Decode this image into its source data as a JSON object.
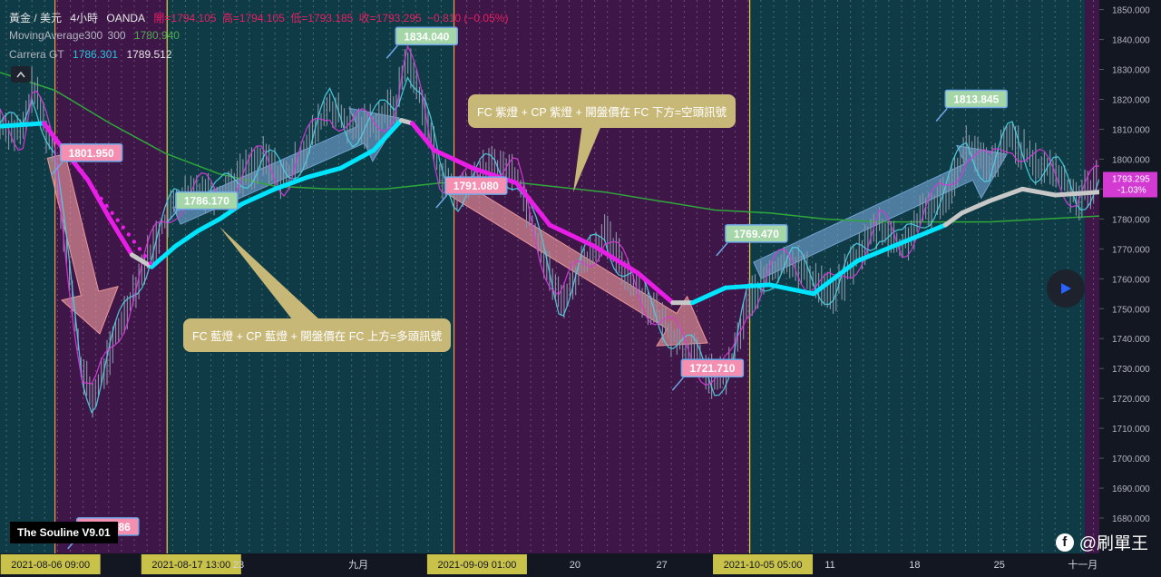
{
  "header": {
    "symbol": "黃金 / 美元",
    "interval": "4小時",
    "exchange": "OANDA",
    "open": "開=1794.105",
    "high": "高=1794.105",
    "low": "低=1793.185",
    "close": "收=1793.295",
    "change": "−0.810 (−0.05%)",
    "ma_name": "MovingAverage300",
    "ma_period": "300",
    "ma_value": "1780.940",
    "carrera_name": "Carrera GT",
    "carrera_v1": "1786.301",
    "carrera_v2": "1789.512"
  },
  "watermark": "The Souline V9.01",
  "brand": "@刷單王",
  "annotations": {
    "short_signal": "FC 紫燈 + CP 紫燈 + 開盤價在 FC 下方=空頭訊號",
    "long_signal": "FC 藍燈 + CP 藍燈 + 開盤價在 FC 上方=多頭訊號"
  },
  "colors": {
    "background": "#131722",
    "teal_zone": "#0f3b46",
    "purple_zone": "#3e1648",
    "fc_bull": "#00e5ff",
    "fc_bear": "#e91ee6",
    "cp_cyan": "#4dd0e1",
    "cp_magenta": "#d63ad6",
    "ma300": "#2fa83a",
    "price_bar": "#8a96a8",
    "label_pink": "#f48fb1",
    "label_green": "#a5d6a7",
    "annotation": "#c8b878"
  },
  "chart_data": {
    "type": "line",
    "title": "黃金 / 美元 4小時 OANDA",
    "price_axis": {
      "ylim": [
        1670,
        1852
      ],
      "ticks": [
        1680,
        1690,
        1700,
        1710,
        1720,
        1730,
        1740,
        1750,
        1760,
        1770,
        1780,
        1790,
        1800,
        1810,
        1820,
        1830,
        1840,
        1850
      ],
      "ticks_display": [
        "1680.000",
        "1690.000",
        "1700.000",
        "1710.000",
        "1720.000",
        "1730.000",
        "1740.000",
        "1750.000",
        "1760.000",
        "1770.000",
        "1780.000",
        "1790.000",
        "1800.000",
        "1810.000",
        "1820.000",
        "1830.000",
        "1840.000",
        "1850.000"
      ],
      "current_price": "1793.295",
      "current_change": "-1.03%"
    },
    "time_axis": {
      "labels": [
        {
          "text": "2021-08-06  09:00",
          "pos": 0.022,
          "highlight": true
        },
        {
          "text": "2021-08-17  13:00",
          "pos": 0.15,
          "highlight": true
        },
        {
          "text": "23",
          "pos": 0.217
        },
        {
          "text": "九月",
          "pos": 0.326
        },
        {
          "text": "2021-09-09  01:00",
          "pos": 0.41,
          "highlight": true
        },
        {
          "text": "20",
          "pos": 0.523
        },
        {
          "text": "27",
          "pos": 0.602
        },
        {
          "text": "2021-10-05  05:00",
          "pos": 0.67,
          "highlight": true
        },
        {
          "text": "11",
          "pos": 0.755
        },
        {
          "text": "18",
          "pos": 0.832
        },
        {
          "text": "25",
          "pos": 0.909
        },
        {
          "text": "十一月",
          "pos": 0.985
        }
      ]
    },
    "zones": [
      {
        "start": 0.0,
        "end": 0.05,
        "type": "teal"
      },
      {
        "start": 0.05,
        "end": 0.152,
        "type": "purple"
      },
      {
        "start": 0.152,
        "end": 0.413,
        "type": "teal"
      },
      {
        "start": 0.413,
        "end": 0.682,
        "type": "purple"
      },
      {
        "start": 0.682,
        "end": 0.777,
        "type": "teal"
      },
      {
        "start": 0.777,
        "end": 0.987,
        "type": "teal"
      },
      {
        "start": 0.987,
        "end": 1.0,
        "type": "purple"
      }
    ],
    "price_path": [
      {
        "t": 0.0,
        "v": 1812
      },
      {
        "t": 0.02,
        "v": 1808
      },
      {
        "t": 0.03,
        "v": 1825
      },
      {
        "t": 0.05,
        "v": 1800
      },
      {
        "t": 0.065,
        "v": 1755
      },
      {
        "t": 0.075,
        "v": 1728
      },
      {
        "t": 0.085,
        "v": 1720
      },
      {
        "t": 0.1,
        "v": 1735
      },
      {
        "t": 0.12,
        "v": 1755
      },
      {
        "t": 0.14,
        "v": 1772
      },
      {
        "t": 0.16,
        "v": 1786
      },
      {
        "t": 0.18,
        "v": 1790
      },
      {
        "t": 0.2,
        "v": 1788
      },
      {
        "t": 0.22,
        "v": 1795
      },
      {
        "t": 0.24,
        "v": 1800
      },
      {
        "t": 0.26,
        "v": 1793
      },
      {
        "t": 0.28,
        "v": 1805
      },
      {
        "t": 0.3,
        "v": 1818
      },
      {
        "t": 0.32,
        "v": 1810
      },
      {
        "t": 0.34,
        "v": 1812
      },
      {
        "t": 0.36,
        "v": 1818
      },
      {
        "t": 0.37,
        "v": 1834
      },
      {
        "t": 0.385,
        "v": 1818
      },
      {
        "t": 0.4,
        "v": 1796
      },
      {
        "t": 0.415,
        "v": 1788
      },
      {
        "t": 0.43,
        "v": 1793
      },
      {
        "t": 0.45,
        "v": 1798
      },
      {
        "t": 0.47,
        "v": 1795
      },
      {
        "t": 0.49,
        "v": 1772
      },
      {
        "t": 0.51,
        "v": 1752
      },
      {
        "t": 0.53,
        "v": 1765
      },
      {
        "t": 0.55,
        "v": 1775
      },
      {
        "t": 0.57,
        "v": 1762
      },
      {
        "t": 0.59,
        "v": 1752
      },
      {
        "t": 0.61,
        "v": 1742
      },
      {
        "t": 0.63,
        "v": 1735
      },
      {
        "t": 0.65,
        "v": 1726
      },
      {
        "t": 0.665,
        "v": 1730
      },
      {
        "t": 0.68,
        "v": 1752
      },
      {
        "t": 0.7,
        "v": 1762
      },
      {
        "t": 0.72,
        "v": 1766
      },
      {
        "t": 0.74,
        "v": 1760
      },
      {
        "t": 0.76,
        "v": 1755
      },
      {
        "t": 0.78,
        "v": 1768
      },
      {
        "t": 0.8,
        "v": 1778
      },
      {
        "t": 0.82,
        "v": 1770
      },
      {
        "t": 0.84,
        "v": 1782
      },
      {
        "t": 0.86,
        "v": 1788
      },
      {
        "t": 0.88,
        "v": 1805
      },
      {
        "t": 0.9,
        "v": 1796
      },
      {
        "t": 0.92,
        "v": 1808
      },
      {
        "t": 0.94,
        "v": 1798
      },
      {
        "t": 0.96,
        "v": 1796
      },
      {
        "t": 0.98,
        "v": 1787
      },
      {
        "t": 1.0,
        "v": 1793
      }
    ],
    "ma300": [
      {
        "t": 0.0,
        "v": 1829
      },
      {
        "t": 0.05,
        "v": 1823
      },
      {
        "t": 0.1,
        "v": 1812
      },
      {
        "t": 0.15,
        "v": 1802
      },
      {
        "t": 0.2,
        "v": 1795
      },
      {
        "t": 0.25,
        "v": 1791
      },
      {
        "t": 0.3,
        "v": 1790
      },
      {
        "t": 0.35,
        "v": 1790
      },
      {
        "t": 0.4,
        "v": 1792
      },
      {
        "t": 0.45,
        "v": 1793
      },
      {
        "t": 0.5,
        "v": 1791
      },
      {
        "t": 0.55,
        "v": 1789
      },
      {
        "t": 0.6,
        "v": 1786
      },
      {
        "t": 0.65,
        "v": 1783
      },
      {
        "t": 0.7,
        "v": 1782
      },
      {
        "t": 0.75,
        "v": 1780
      },
      {
        "t": 0.8,
        "v": 1779
      },
      {
        "t": 0.85,
        "v": 1779
      },
      {
        "t": 0.9,
        "v": 1779
      },
      {
        "t": 0.95,
        "v": 1780
      },
      {
        "t": 1.0,
        "v": 1781
      }
    ],
    "fc_line": [
      {
        "t": 0.0,
        "v": 1811,
        "c": "bull"
      },
      {
        "t": 0.04,
        "v": 1812,
        "c": "bull"
      },
      {
        "t": 0.052,
        "v": 1806,
        "c": "bear"
      },
      {
        "t": 0.08,
        "v": 1793,
        "c": "bear"
      },
      {
        "t": 0.1,
        "v": 1780,
        "c": "bear"
      },
      {
        "t": 0.12,
        "v": 1768,
        "c": "bear"
      },
      {
        "t": 0.138,
        "v": 1764,
        "c": "neutral"
      },
      {
        "t": 0.16,
        "v": 1771,
        "c": "bull"
      },
      {
        "t": 0.18,
        "v": 1776,
        "c": "bull"
      },
      {
        "t": 0.2,
        "v": 1780,
        "c": "bull"
      },
      {
        "t": 0.22,
        "v": 1785,
        "c": "bull"
      },
      {
        "t": 0.25,
        "v": 1790,
        "c": "bull"
      },
      {
        "t": 0.28,
        "v": 1794,
        "c": "bull"
      },
      {
        "t": 0.31,
        "v": 1797,
        "c": "bull"
      },
      {
        "t": 0.34,
        "v": 1803,
        "c": "bull"
      },
      {
        "t": 0.365,
        "v": 1813,
        "c": "bull"
      },
      {
        "t": 0.375,
        "v": 1812,
        "c": "neutral"
      },
      {
        "t": 0.395,
        "v": 1803,
        "c": "bear"
      },
      {
        "t": 0.43,
        "v": 1797,
        "c": "bear"
      },
      {
        "t": 0.47,
        "v": 1792,
        "c": "bear"
      },
      {
        "t": 0.5,
        "v": 1778,
        "c": "bear"
      },
      {
        "t": 0.54,
        "v": 1771,
        "c": "bear"
      },
      {
        "t": 0.58,
        "v": 1762,
        "c": "bear"
      },
      {
        "t": 0.612,
        "v": 1752,
        "c": "bear"
      },
      {
        "t": 0.63,
        "v": 1752,
        "c": "neutral"
      },
      {
        "t": 0.66,
        "v": 1757,
        "c": "bull"
      },
      {
        "t": 0.7,
        "v": 1758,
        "c": "bull"
      },
      {
        "t": 0.74,
        "v": 1755,
        "c": "bull"
      },
      {
        "t": 0.78,
        "v": 1766,
        "c": "bull"
      },
      {
        "t": 0.82,
        "v": 1772,
        "c": "bull"
      },
      {
        "t": 0.86,
        "v": 1778,
        "c": "bull"
      },
      {
        "t": 0.875,
        "v": 1782,
        "c": "neutral"
      },
      {
        "t": 0.9,
        "v": 1786,
        "c": "neutral"
      },
      {
        "t": 0.93,
        "v": 1790,
        "c": "neutral"
      },
      {
        "t": 0.96,
        "v": 1788,
        "c": "neutral"
      },
      {
        "t": 1.0,
        "v": 1789,
        "c": "neutral"
      }
    ],
    "price_labels": [
      {
        "text": "1801.950",
        "t": 0.05,
        "v": 1802,
        "color": "pink"
      },
      {
        "text": "1677.686",
        "t": 0.065,
        "v": 1677,
        "color": "pink"
      },
      {
        "text": "1786.170",
        "t": 0.155,
        "v": 1786,
        "color": "green"
      },
      {
        "text": "1834.040",
        "t": 0.355,
        "v": 1841,
        "color": "green"
      },
      {
        "text": "1791.080",
        "t": 0.4,
        "v": 1791,
        "color": "pink"
      },
      {
        "text": "1721.710",
        "t": 0.615,
        "v": 1730,
        "color": "pink"
      },
      {
        "text": "1769.470",
        "t": 0.655,
        "v": 1775,
        "color": "green"
      },
      {
        "text": "1813.845",
        "t": 0.855,
        "v": 1820,
        "color": "green"
      }
    ]
  }
}
